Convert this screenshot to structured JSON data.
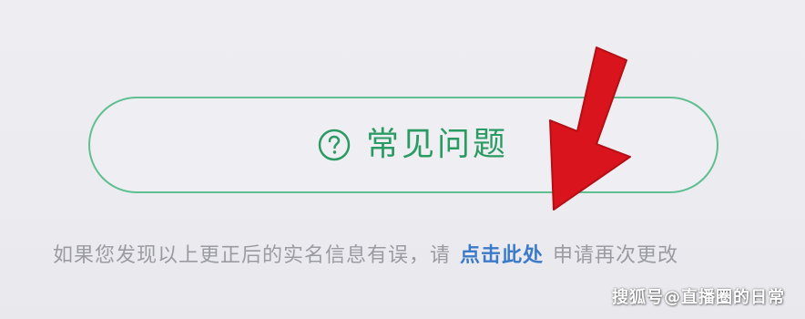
{
  "faq_button": {
    "label": "常见问题",
    "icon": "question-circle-icon"
  },
  "notice": {
    "prefix": "如果您发现以上更正后的实名信息有误，请",
    "link_label": "点击此处",
    "suffix": "申请再次更改"
  },
  "watermark": "搜狐号@直播圈的日常",
  "colors": {
    "accent_green": "#2a9b63",
    "border_green": "#5fbf91",
    "link_blue": "#3b7ac9",
    "arrow_red": "#d9141c",
    "muted_text": "#9a9aa1"
  }
}
